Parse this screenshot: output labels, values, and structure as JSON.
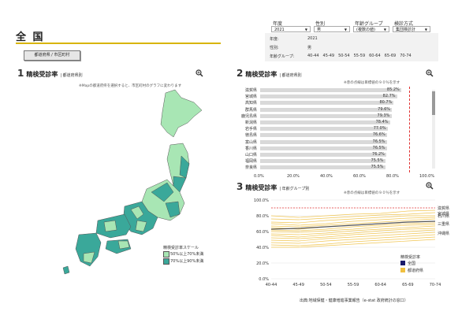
{
  "page": {
    "title": "全 国",
    "toggle_label": "都道府県 / 市区町村",
    "footer": "出典:地域保健・健康増進事業報告（e-stat 政府統計の窓口）"
  },
  "filters": [
    {
      "label": "年度",
      "value": "2021"
    },
    {
      "label": "性別",
      "value": "男"
    },
    {
      "label": "年齢グループ",
      "value": "(複数の値)"
    },
    {
      "label": "検診方式",
      "value": "集団検診計"
    }
  ],
  "summary": {
    "year_label": "年度:",
    "year": "2021",
    "sex_label": "性別:",
    "sex": "男",
    "age_label": "年齢グループ:",
    "ages": [
      "40-44",
      "45-49",
      "50-54",
      "55-59",
      "60-64",
      "65-69",
      "70-74"
    ]
  },
  "section1": {
    "num": "1",
    "title": "精検受診率",
    "subtitle": "| 都道府県別",
    "note": "※Mapの都道府県を選択すると、市区町村のグラフに変わります",
    "legend_title": "精検受診率スケール",
    "legend_items": [
      {
        "label": "50%以上70%未満",
        "color": "#a8e6b4"
      },
      {
        "label": "70%以上90%未満",
        "color": "#3aa89a"
      }
    ]
  },
  "section2": {
    "num": "2",
    "title": "精検受診率",
    "subtitle": "| 都道府県別",
    "note": "※赤の点線は目標値の９０％を示す",
    "bar_color": "#d9d9d9",
    "target_color": "#e03030"
  },
  "section3": {
    "num": "3",
    "title": "精検受診率",
    "subtitle": "| 年齢グループ別",
    "note": "※赤の点線は目標値の９０％を示す",
    "legend_title": "精検受診率",
    "legend_items": [
      {
        "label": "全国",
        "color": "#1a1a6a"
      },
      {
        "label": "都道府県",
        "color": "#f0c040"
      }
    ],
    "right_labels": [
      "滋賀県",
      "宮城県",
      "石川県",
      "三重県",
      "沖縄県"
    ]
  },
  "chart_data": [
    {
      "type": "bar",
      "orientation": "horizontal",
      "title": "精検受診率 | 都道府県別",
      "categories": [
        "滋賀県",
        "宮城県",
        "高知県",
        "群馬県",
        "鹿児島県",
        "新潟県",
        "岩手県",
        "徳島県",
        "富山県",
        "香川県",
        "山口県",
        "福岡県",
        "奈良県"
      ],
      "values": [
        85.2,
        82.7,
        80.7,
        79.6,
        79.3,
        78.4,
        77.0,
        76.6,
        76.5,
        76.5,
        76.2,
        75.5,
        75.5
      ],
      "value_labels": [
        "85.2%",
        "82.7%",
        "80.7%",
        "79.6%",
        "79.3%",
        "78.4%",
        "77.0%",
        "76.6%",
        "76.5%",
        "76.5%",
        "76.2%",
        "75.5%",
        "75.5%"
      ],
      "xlim": [
        0,
        100
      ],
      "xticks": [
        "0.0%",
        "20.0%",
        "40.0%",
        "60.0%",
        "80.0%",
        "100.0%"
      ],
      "target_line": 90
    },
    {
      "type": "line",
      "title": "精検受診率 | 年齢グループ別",
      "x": [
        "40-44",
        "45-49",
        "50-54",
        "55-59",
        "60-64",
        "65-69",
        "70-74"
      ],
      "ylim": [
        0,
        100
      ],
      "yticks": [
        "0.0%",
        "20.0%",
        "40.0%",
        "60.0%",
        "80.0%",
        "100.0%"
      ],
      "target_line": 90,
      "series": [
        {
          "name": "全国",
          "values": [
            63,
            64,
            66,
            68,
            70,
            72,
            73
          ]
        },
        {
          "name": "都道府県",
          "values": [
            80,
            78,
            80,
            82,
            83,
            86,
            87
          ]
        },
        {
          "name": "都道府県",
          "values": [
            76,
            75,
            77,
            79,
            81,
            82,
            84
          ]
        },
        {
          "name": "都道府県",
          "values": [
            72,
            71,
            74,
            76,
            78,
            80,
            80
          ]
        },
        {
          "name": "都道府県",
          "values": [
            70,
            68,
            70,
            73,
            75,
            77,
            78
          ]
        },
        {
          "name": "都道府県",
          "values": [
            67,
            66,
            68,
            70,
            72,
            74,
            76
          ]
        },
        {
          "name": "都道府県",
          "values": [
            65,
            63,
            66,
            68,
            70,
            72,
            73
          ]
        },
        {
          "name": "都道府県",
          "values": [
            62,
            61,
            63,
            66,
            68,
            70,
            71
          ]
        },
        {
          "name": "都道府県",
          "values": [
            60,
            59,
            61,
            63,
            66,
            68,
            69
          ]
        },
        {
          "name": "都道府県",
          "values": [
            57,
            56,
            58,
            61,
            63,
            65,
            67
          ]
        },
        {
          "name": "都道府県",
          "values": [
            55,
            53,
            56,
            58,
            61,
            63,
            64
          ]
        },
        {
          "name": "都道府県",
          "values": [
            52,
            51,
            53,
            56,
            58,
            60,
            62
          ]
        },
        {
          "name": "都道府県",
          "values": [
            49,
            48,
            51,
            53,
            55,
            57,
            59
          ]
        },
        {
          "name": "都道府県",
          "values": [
            46,
            45,
            48,
            50,
            52,
            54,
            56
          ]
        },
        {
          "name": "都道府県",
          "values": [
            43,
            42,
            44,
            47,
            49,
            51,
            53
          ]
        },
        {
          "name": "都道府県",
          "values": [
            40,
            40,
            42,
            44,
            46,
            48,
            50
          ]
        }
      ]
    }
  ]
}
